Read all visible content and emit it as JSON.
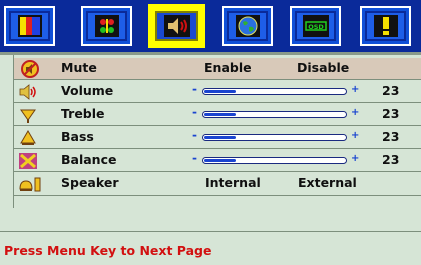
{
  "tabs": [
    {
      "name": "picture-tab",
      "icon": "color-bars-icon",
      "active": false
    },
    {
      "name": "color-tab",
      "icon": "rgb-dots-icon",
      "active": false
    },
    {
      "name": "audio-tab",
      "icon": "speaker-icon",
      "active": true
    },
    {
      "name": "globe-tab",
      "icon": "globe-icon",
      "active": false
    },
    {
      "name": "osd-tab",
      "icon": "osd-icon",
      "active": false,
      "text": "OSD"
    },
    {
      "name": "exclaim-tab",
      "icon": "exclamation-icon",
      "active": false
    }
  ],
  "menu": {
    "mute": {
      "label": "Mute",
      "opt1": "Enable",
      "opt2": "Disable",
      "icon": "mute-icon"
    },
    "volume": {
      "label": "Volume",
      "value": "23",
      "level": 0.23,
      "icon": "volume-icon"
    },
    "treble": {
      "label": "Treble",
      "value": "23",
      "level": 0.23,
      "icon": "treble-icon"
    },
    "bass": {
      "label": "Bass",
      "value": "23",
      "level": 0.23,
      "icon": "bass-icon"
    },
    "balance": {
      "label": "Balance",
      "value": "23",
      "level": 0.23,
      "icon": "balance-icon"
    },
    "speaker": {
      "label": "Speaker",
      "opt1": "Internal",
      "opt2": "External",
      "icon": "speaker-select-icon"
    }
  },
  "slider_symbols": {
    "minus": "-",
    "plus": "+"
  },
  "footer": {
    "hint": "Press Menu Key to Next Page"
  },
  "colors": {
    "bar_bg": "#0a2a9a",
    "tab_bg": "#1050d8",
    "active": "#ffff00",
    "panel": "#d6e5d6",
    "selected_row": "#d8c9b9",
    "hint": "#d21010",
    "slider": "#1a44d0"
  }
}
